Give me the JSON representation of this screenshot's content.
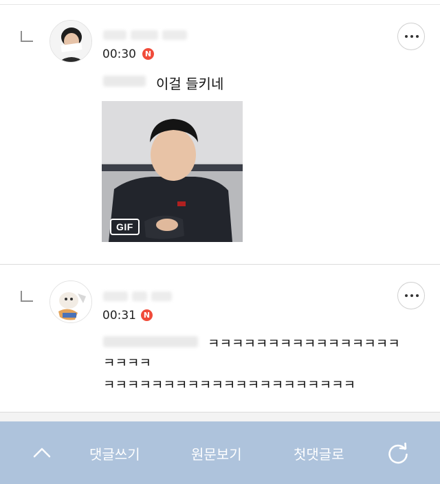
{
  "comments": [
    {
      "nickname": "",
      "time": "00:30",
      "new_badge": "N",
      "text": "이걸 들키네",
      "gif_label": "GIF"
    },
    {
      "nickname": "",
      "time": "00:31",
      "new_badge": "N",
      "text_line1": "ㅋㅋㅋㅋㅋㅋㅋㅋㅋㅋㅋㅋㅋㅋㅋㅋ",
      "text_line2": "ㅋㅋㅋㅋ",
      "text_line3": "ㅋㅋㅋㅋㅋㅋㅋㅋㅋㅋㅋㅋㅋㅋㅋㅋㅋㅋㅋㅋㅋ"
    }
  ],
  "bottom_bar": {
    "write_comment": "댓글쓰기",
    "view_original": "원문보기",
    "first_comment": "첫댓글로"
  },
  "colors": {
    "badge": "#f04b3a",
    "bottom_bar": "#aec3dc"
  }
}
